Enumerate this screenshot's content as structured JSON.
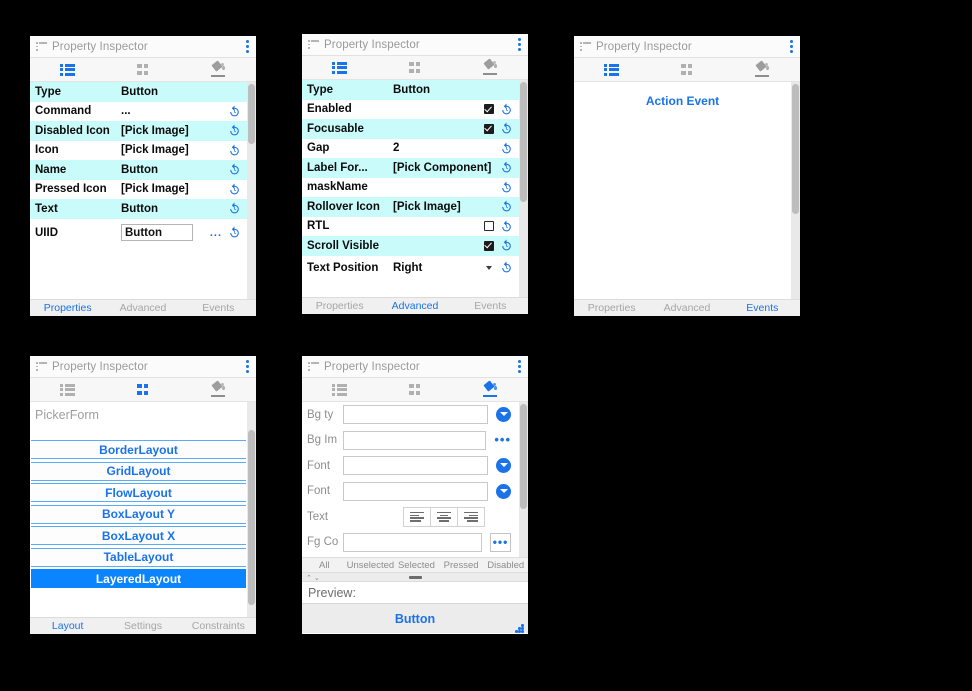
{
  "colors": {
    "accent": "#1a73e8",
    "row_alt": "#c9fbfb",
    "selected_layout": "#0a84ff",
    "title_gray": "#9a9a9a"
  },
  "panel_title": "Property Inspector",
  "icon_tabs": [
    {
      "name": "list-view-icon",
      "id": "list"
    },
    {
      "name": "grid-view-icon",
      "id": "grid"
    },
    {
      "name": "paint-bucket-icon",
      "id": "bucket"
    }
  ],
  "panels": {
    "properties": {
      "title": "Property Inspector",
      "active_icon_tab": 0,
      "rows": [
        {
          "key": "Type",
          "value": "Button",
          "control": "none",
          "alt": true
        },
        {
          "key": "Command",
          "value": "...",
          "control": "revert",
          "alt": false
        },
        {
          "key": "Disabled Icon",
          "value": "[Pick Image]",
          "control": "revert",
          "alt": true
        },
        {
          "key": "Icon",
          "value": "[Pick Image]",
          "control": "revert",
          "alt": false
        },
        {
          "key": "Name",
          "value": "Button",
          "control": "revert",
          "alt": true
        },
        {
          "key": "Pressed Icon",
          "value": "[Pick Image]",
          "control": "revert",
          "alt": false
        },
        {
          "key": "Text",
          "value": "Button",
          "control": "revert",
          "alt": true
        },
        {
          "key": "UIID",
          "value": "Button",
          "control": "input-ellipsis-revert",
          "alt": false
        }
      ],
      "bottom_tabs": [
        {
          "label": "Properties",
          "selected": true
        },
        {
          "label": "Advanced",
          "selected": false
        },
        {
          "label": "Events",
          "selected": false
        }
      ]
    },
    "advanced": {
      "title": "Property Inspector",
      "active_icon_tab": 0,
      "rows": [
        {
          "key": "Type",
          "value": "Button",
          "control": "none",
          "alt": true
        },
        {
          "key": "Enabled",
          "value": "",
          "control": "checkbox-on",
          "alt": false
        },
        {
          "key": "Focusable",
          "value": "",
          "control": "checkbox-on",
          "alt": true
        },
        {
          "key": "Gap",
          "value": "2",
          "control": "revert",
          "alt": false
        },
        {
          "key": "Label For...",
          "value": "[Pick Component]",
          "control": "revert",
          "alt": true
        },
        {
          "key": "maskName",
          "value": "",
          "control": "revert",
          "alt": false
        },
        {
          "key": "Rollover Icon",
          "value": "[Pick Image]",
          "control": "revert",
          "alt": true
        },
        {
          "key": "RTL",
          "value": "",
          "control": "checkbox-off",
          "alt": false
        },
        {
          "key": "Scroll Visible",
          "value": "",
          "control": "checkbox-on",
          "alt": true
        },
        {
          "key": "Text Position",
          "value": "Right",
          "control": "dropdown-revert",
          "alt": false
        }
      ],
      "bottom_tabs": [
        {
          "label": "Properties",
          "selected": false
        },
        {
          "label": "Advanced",
          "selected": true
        },
        {
          "label": "Events",
          "selected": false
        }
      ]
    },
    "events": {
      "title": "Property Inspector",
      "active_icon_tab": 0,
      "event_link": "Action Event",
      "bottom_tabs": [
        {
          "label": "Properties",
          "selected": false
        },
        {
          "label": "Advanced",
          "selected": false
        },
        {
          "label": "Events",
          "selected": true
        }
      ]
    },
    "layout": {
      "title": "Property Inspector",
      "active_icon_tab": 1,
      "form_name": "PickerForm",
      "layouts": [
        {
          "label": "BorderLayout",
          "selected": false
        },
        {
          "label": "GridLayout",
          "selected": false
        },
        {
          "label": "FlowLayout",
          "selected": false
        },
        {
          "label": "BoxLayout Y",
          "selected": false
        },
        {
          "label": "BoxLayout X",
          "selected": false
        },
        {
          "label": "TableLayout",
          "selected": false
        },
        {
          "label": "LayeredLayout",
          "selected": true
        }
      ],
      "bottom_tabs": [
        {
          "label": "Layout",
          "selected": true
        },
        {
          "label": "Settings",
          "selected": false
        },
        {
          "label": "Constraints",
          "selected": false
        }
      ]
    },
    "style": {
      "title": "Property Inspector",
      "active_icon_tab": 2,
      "rows": [
        {
          "key": "Bg ty",
          "value": "",
          "control": "round-dropdown"
        },
        {
          "key": "Bg Im",
          "value": "",
          "control": "dots"
        },
        {
          "key": "Font ",
          "value": "",
          "control": "round-dropdown"
        },
        {
          "key": "Font ",
          "value": "",
          "control": "round-dropdown"
        },
        {
          "key": "Text ",
          "value": "",
          "control": "align-group"
        },
        {
          "key": "Fg Co",
          "value": "",
          "control": "boxed-dots"
        }
      ],
      "align_buttons": [
        {
          "name": "align-left-button"
        },
        {
          "name": "align-center-button"
        },
        {
          "name": "align-right-button"
        }
      ],
      "state_tabs": [
        {
          "label": "All"
        },
        {
          "label": "Unselected"
        },
        {
          "label": "Selected"
        },
        {
          "label": "Pressed"
        },
        {
          "label": "Disabled"
        }
      ],
      "preview_label": "Preview:",
      "preview_button": "Button",
      "bottom_tabs": []
    }
  }
}
